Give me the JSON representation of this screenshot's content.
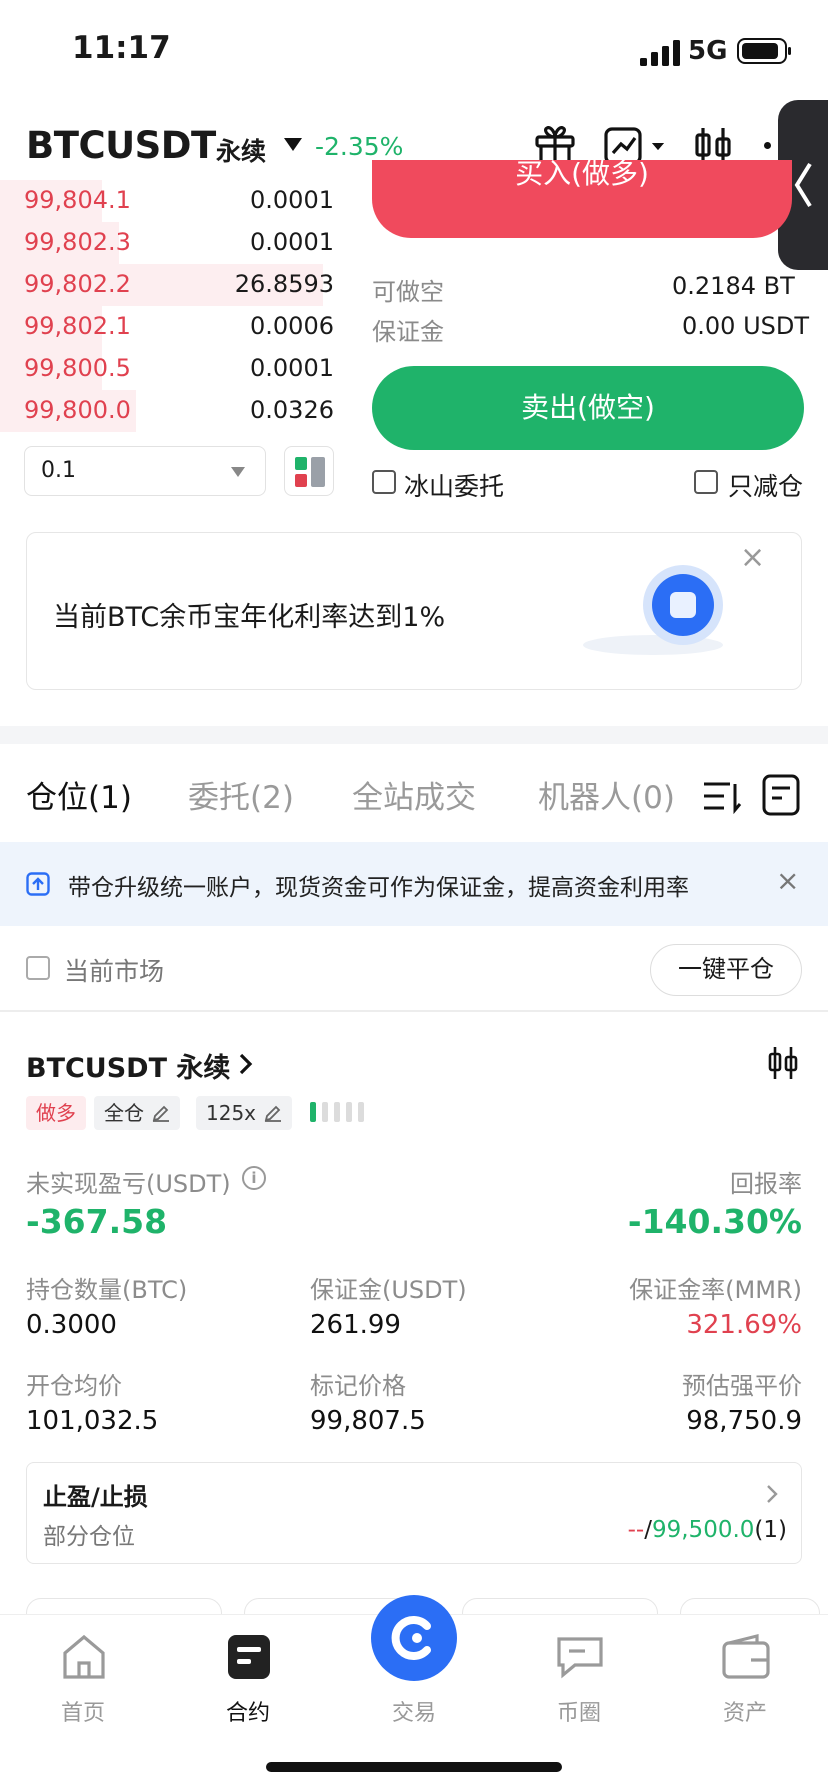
{
  "status_bar": {
    "time": "11:17",
    "network": "5G"
  },
  "header": {
    "symbol": "BTCUSDT",
    "contract_type": "永续",
    "change": "-2.35%"
  },
  "order_book": {
    "asks": [
      {
        "price": "99,804.1",
        "qty": "0.0001",
        "depth": 0.3
      },
      {
        "price": "99,802.3",
        "qty": "0.0001",
        "depth": 0.35
      },
      {
        "price": "99,802.2",
        "qty": "26.8593",
        "depth": 0.95
      },
      {
        "price": "99,802.1",
        "qty": "0.0006",
        "depth": 0.3
      },
      {
        "price": "99,800.5",
        "qty": "0.0001",
        "depth": 0.3
      },
      {
        "price": "99,800.0",
        "qty": "0.0326",
        "depth": 0.4
      }
    ],
    "qty_selector": "0.1"
  },
  "trade_panel": {
    "buy_label": "买入(做多)",
    "available_short_label": "可做空",
    "available_short_value": "0.2184 BT",
    "margin_label": "保证金",
    "margin_value": "0.00 USDT",
    "sell_label": "卖出(做空)",
    "iceberg_label": "冰山委托",
    "reduce_only_label": "只减仓"
  },
  "promo": {
    "text": "当前BTC余币宝年化利率达到1%",
    "close": "×"
  },
  "tabs": [
    {
      "label": "仓位(1)"
    },
    {
      "label": "委托(2)"
    },
    {
      "label": "全站成交"
    },
    {
      "label": "机器人(0)"
    }
  ],
  "notice": {
    "text": "带仓升级统一账户，现货资金可作为保证金，提高资金利用率",
    "close": "×"
  },
  "filter": {
    "current_market_label": "当前市场",
    "close_all_label": "一键平仓"
  },
  "position": {
    "title": "BTCUSDT 永续",
    "tags": {
      "side": "做多",
      "margin_mode": "全仓",
      "leverage": "125x"
    },
    "pnl_label": "未实现盈亏(USDT)",
    "pnl_value": "-367.58",
    "roe_label": "回报率",
    "roe_value": "-140.30%",
    "size_label": "持仓数量(BTC)",
    "size_value": "0.3000",
    "margin_label": "保证金(USDT)",
    "margin_value": "261.99",
    "mmr_label": "保证金率(MMR)",
    "mmr_value": "321.69%",
    "entry_label": "开仓均价",
    "entry_value": "101,032.5",
    "mark_label": "标记价格",
    "mark_value": "99,807.5",
    "liq_label": "预估强平价",
    "liq_value": "98,750.9",
    "tpsl_title": "止盈/止损",
    "tpsl_sub": "部分仓位",
    "tpsl_tp": "--",
    "tpsl_sep": "/",
    "tpsl_sl": "99,500.0",
    "tpsl_count": "(1)"
  },
  "nav": [
    {
      "label": "首页",
      "icon": "home-icon"
    },
    {
      "label": "合约",
      "icon": "contract-icon"
    },
    {
      "label": "交易",
      "icon": "trade-icon"
    },
    {
      "label": "币圈",
      "icon": "community-icon"
    },
    {
      "label": "资产",
      "icon": "wallet-icon"
    }
  ],
  "colors": {
    "up": "#1fb36a",
    "down": "#e0414f",
    "buy": "#f04a5d",
    "sell": "#1fb36a",
    "accent": "#2b6ef5"
  }
}
